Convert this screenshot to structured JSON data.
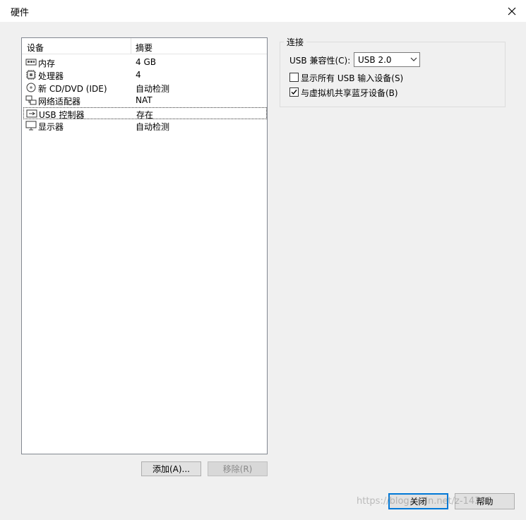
{
  "window": {
    "title": "硬件"
  },
  "device_list": {
    "columns": {
      "device": "设备",
      "summary": "摘要"
    },
    "rows": [
      {
        "icon": "memory-icon",
        "name": "内存",
        "summary": "4 GB"
      },
      {
        "icon": "processor-icon",
        "name": "处理器",
        "summary": "4"
      },
      {
        "icon": "cd-dvd-icon",
        "name": "新 CD/DVD (IDE)",
        "summary": "自动检测"
      },
      {
        "icon": "network-adapter-icon",
        "name": "网络适配器",
        "summary": "NAT"
      },
      {
        "icon": "usb-controller-icon",
        "name": "USB 控制器",
        "summary": "存在",
        "selected": true
      },
      {
        "icon": "display-icon",
        "name": "显示器",
        "summary": "自动检测"
      }
    ]
  },
  "buttons": {
    "add": "添加(A)...",
    "remove": "移除(R)",
    "close": "关闭",
    "help": "帮助"
  },
  "connection": {
    "group_title": "连接",
    "usb_compat_label": "USB 兼容性(C):",
    "usb_compat_value": "USB 2.0",
    "show_all_usb": {
      "label": "显示所有 USB 输入设备(S)",
      "checked": false
    },
    "share_bluetooth": {
      "label": "与虚拟机共享蓝牙设备(B)",
      "checked": true
    }
  },
  "watermark": "https://blog.csdn.net/z-14308",
  "colors": {
    "accent": "#0078d7",
    "dialog_bg": "#f0f0f0",
    "list_border": "#828790"
  }
}
